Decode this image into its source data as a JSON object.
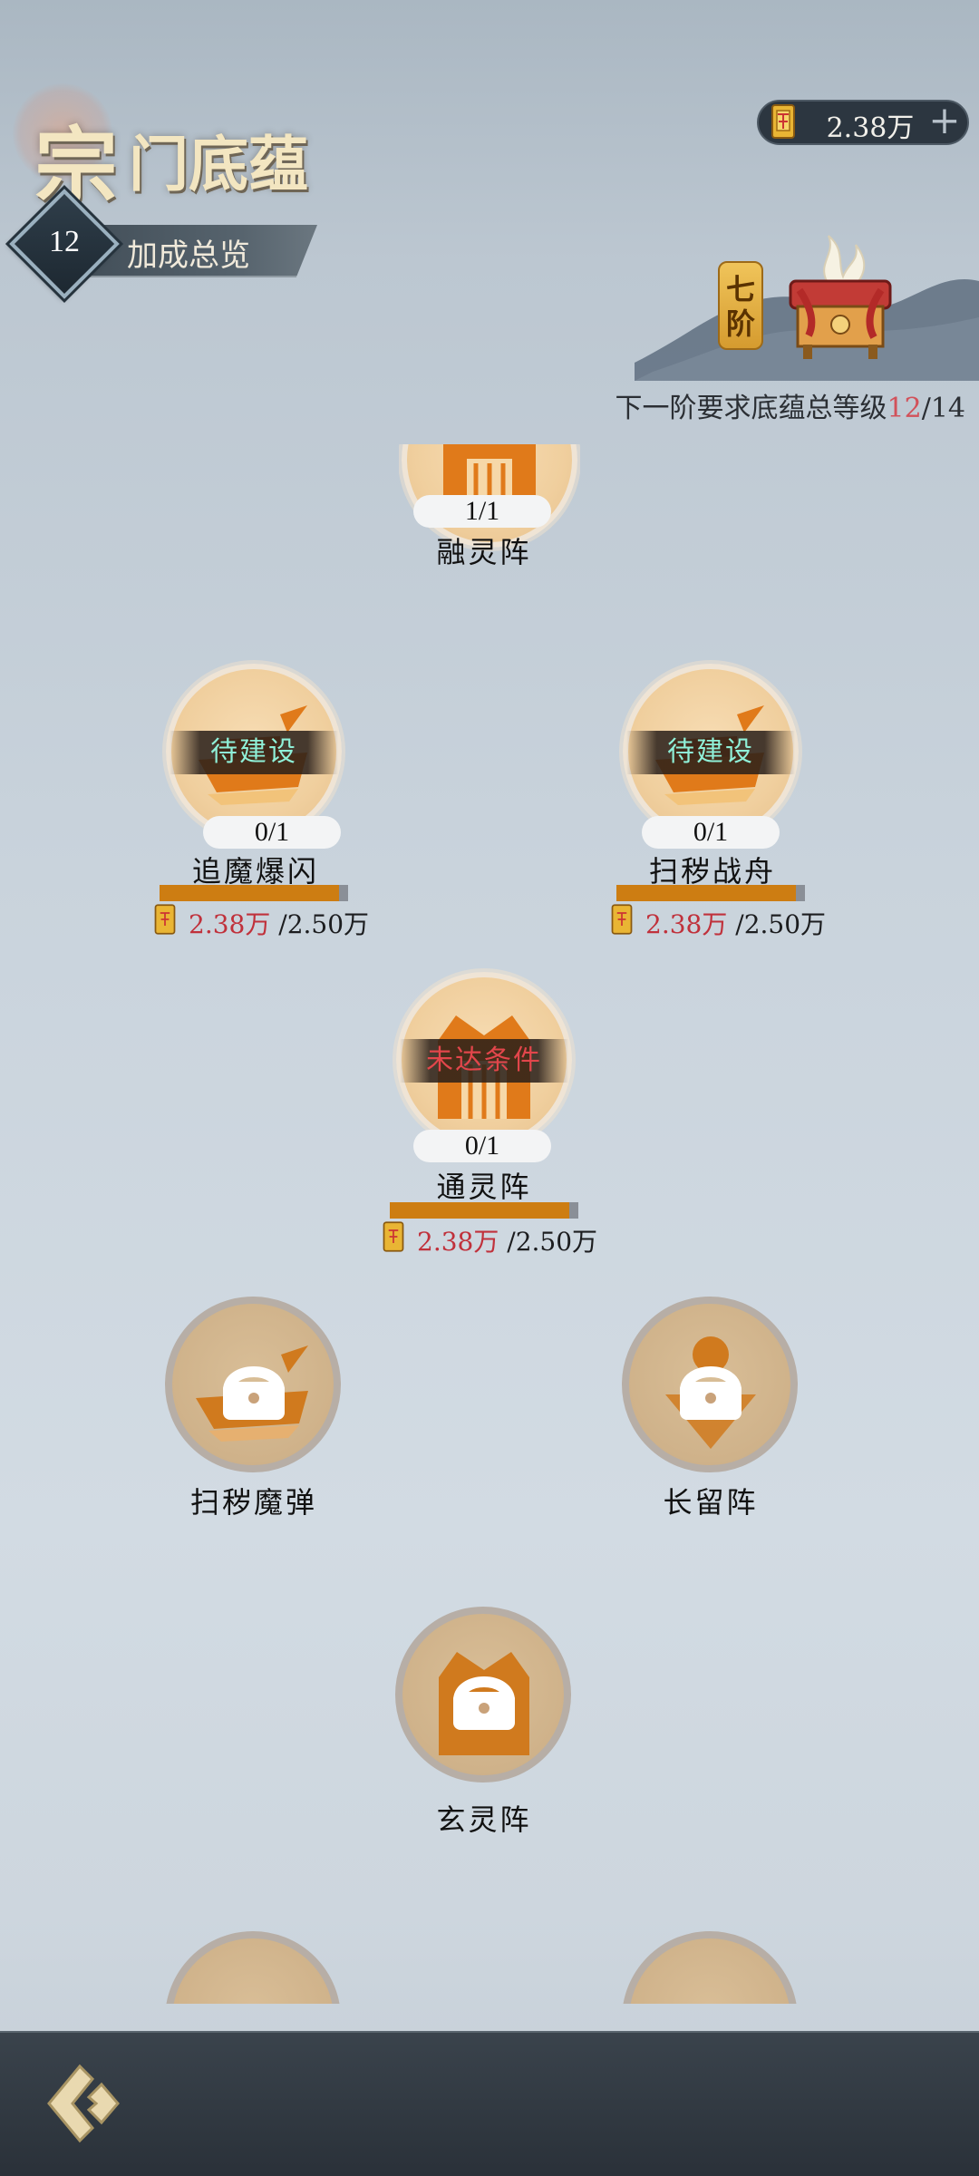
{
  "header": {
    "title_first": "宗",
    "title_rest": "门底蕴",
    "level": "12",
    "overview_label": "加成总览",
    "currency_value": "2.38万",
    "currency_plus": "+",
    "tier_badge": "七阶",
    "tier_req_prefix": "下一阶要求底蕴总等级",
    "tier_req_current": "12",
    "tier_req_sep": "/",
    "tier_req_target": "14"
  },
  "colors": {
    "accent_orange": "#cd7d12",
    "insufficient_red": "#c0313b",
    "build_teal": "#8ff0d8",
    "unmet_red": "#e2464b"
  },
  "nodes": [
    {
      "name": "融灵阵",
      "count": "1/1",
      "state": "",
      "icon": "gate-icon"
    },
    {
      "name": "追魔爆闪",
      "count": "0/1",
      "state": "待建设",
      "cost_current": "2.38万",
      "cost_total": "/2.50万",
      "progress": 0.952,
      "icon": "ship-icon"
    },
    {
      "name": "扫秽战舟",
      "count": "0/1",
      "state": "待建设",
      "cost_current": "2.38万",
      "cost_total": "/2.50万",
      "progress": 0.952,
      "icon": "ship-icon"
    },
    {
      "name": "通灵阵",
      "count": "0/1",
      "state": "未达条件",
      "cost_current": "2.38万",
      "cost_total": "/2.50万",
      "progress": 0.952,
      "icon": "gate-icon"
    },
    {
      "name": "扫秽魔弹",
      "state": "locked",
      "icon": "ship-lock-icon"
    },
    {
      "name": "长留阵",
      "state": "locked",
      "icon": "shield-lock-icon"
    },
    {
      "name": "玄灵阵",
      "state": "locked",
      "icon": "gate-lock-icon"
    }
  ]
}
